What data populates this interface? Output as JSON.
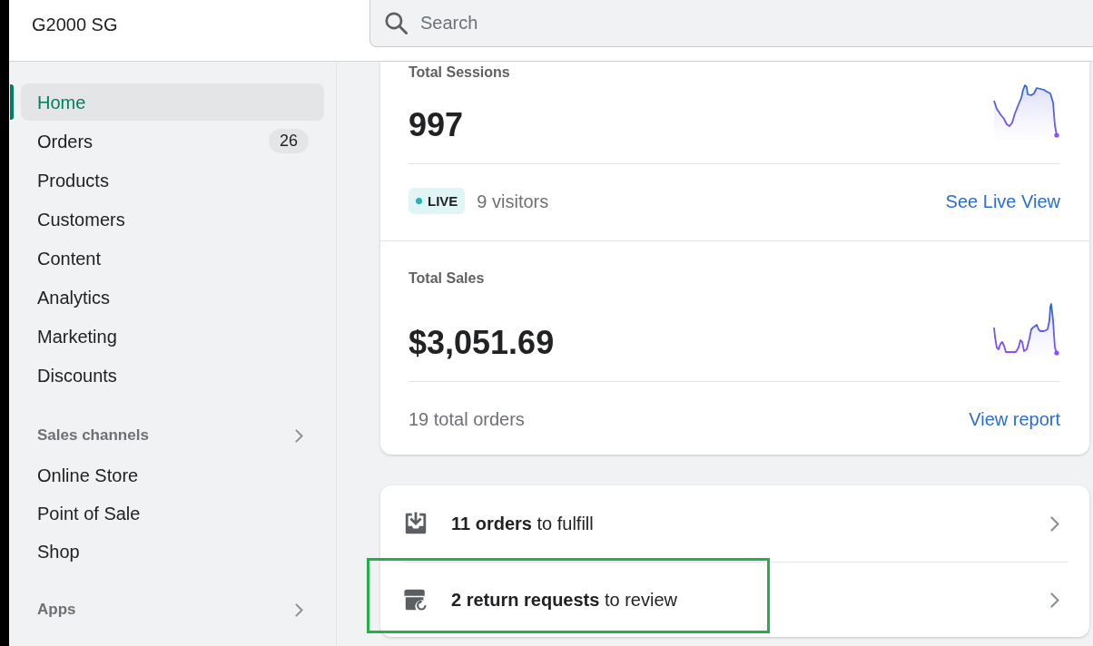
{
  "store": {
    "name": "G2000 SG"
  },
  "search": {
    "placeholder": "Search"
  },
  "sidebar": {
    "items": [
      {
        "label": "Home",
        "selected": true
      },
      {
        "label": "Orders",
        "selected": false,
        "badge": "26"
      },
      {
        "label": "Products",
        "selected": false
      },
      {
        "label": "Customers",
        "selected": false
      },
      {
        "label": "Content",
        "selected": false
      },
      {
        "label": "Analytics",
        "selected": false
      },
      {
        "label": "Marketing",
        "selected": false
      },
      {
        "label": "Discounts",
        "selected": false
      }
    ],
    "sections": [
      {
        "title": "Sales channels",
        "items": [
          {
            "label": "Online Store",
            "selected": false
          },
          {
            "label": "Point of Sale",
            "selected": false
          },
          {
            "label": "Shop",
            "selected": false
          }
        ]
      },
      {
        "title": "Apps"
      }
    ]
  },
  "metrics": [
    {
      "title": "Total Sessions",
      "value": "997",
      "footer": {
        "kind": "live",
        "badge": "LIVE",
        "text": "9 visitors"
      },
      "link": "See Live View"
    },
    {
      "title": "Total Sales",
      "value": "$3,051.69",
      "footer": {
        "kind": "plain",
        "text": "19 total orders"
      },
      "link": "View report"
    }
  ],
  "tasks": [
    {
      "kind": "fulfill",
      "text": "**11 orders** to fulfill",
      "highlighted": false
    },
    {
      "kind": "return",
      "text": "**2 return requests** to review",
      "highlighted": true
    }
  ]
}
